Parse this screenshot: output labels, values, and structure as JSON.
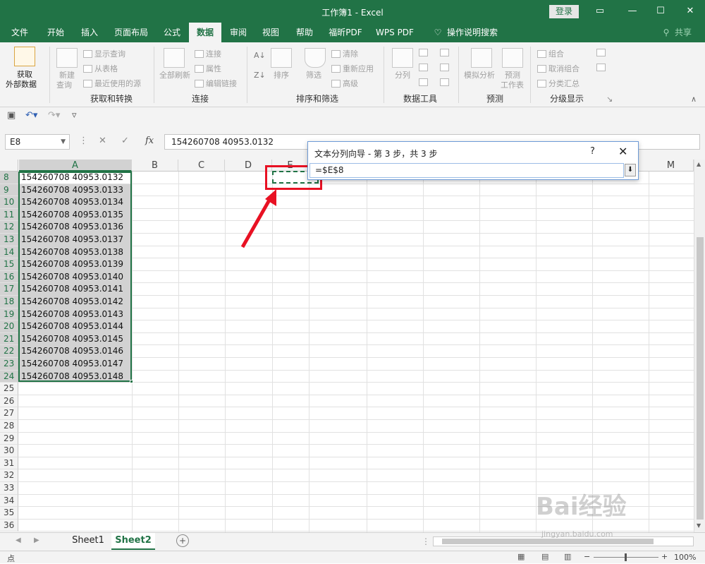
{
  "title": {
    "text": "工作簿1  -  Excel",
    "login": "登录"
  },
  "tabs": [
    "文件",
    "开始",
    "插入",
    "页面布局",
    "公式",
    "数据",
    "审阅",
    "视图",
    "帮助",
    "福昕PDF",
    "WPS PDF",
    "操作说明搜索"
  ],
  "share": "共享",
  "ribbon": {
    "get": {
      "line1": "获取",
      "line2": "外部数据",
      "new_query": "新建",
      "new_query2": "查询",
      "show_queries": "显示查询",
      "from_table": "从表格",
      "recent_sources": "最近使用的源",
      "label": "获取和转换"
    },
    "conn": {
      "refresh_all": "全部刷新",
      "connections": "连接",
      "properties": "属性",
      "edit_links": "编辑链接",
      "label": "连接"
    },
    "sort": {
      "sort": "排序",
      "filter": "筛选",
      "clear": "清除",
      "reapply": "重新应用",
      "advanced": "高级",
      "label": "排序和筛选"
    },
    "tools": {
      "split": "分列",
      "label": "数据工具"
    },
    "forecast": {
      "whatif": "模拟分析",
      "sheet1": "预测",
      "sheet2": "工作表",
      "label": "预测"
    },
    "outline": {
      "group": "组合",
      "ungroup": "取消组合",
      "subtotal": "分类汇总",
      "label": "分级显示"
    }
  },
  "formula_bar": {
    "name_box": "E8",
    "fx": "fx",
    "content": "154260708 40953.0132"
  },
  "columns": [
    "A",
    "B",
    "C",
    "D",
    "E",
    "M"
  ],
  "rows": [
    "8",
    "9",
    "10",
    "11",
    "12",
    "13",
    "14",
    "15",
    "16",
    "17",
    "18",
    "19",
    "20",
    "21",
    "22",
    "23",
    "24",
    "25",
    "26",
    "27",
    "28",
    "29",
    "30",
    "31",
    "32",
    "33",
    "34",
    "35",
    "36"
  ],
  "cells": [
    "154260708 40953.0132",
    "154260708 40953.0133",
    "154260708 40953.0134",
    "154260708 40953.0135",
    "154260708 40953.0136",
    "154260708 40953.0137",
    "154260708 40953.0138",
    "154260708 40953.0139",
    "154260708 40953.0140",
    "154260708 40953.0141",
    "154260708 40953.0142",
    "154260708 40953.0143",
    "154260708 40953.0144",
    "154260708 40953.0145",
    "154260708 40953.0146",
    "154260708 40953.0147",
    "154260708 40953.0148"
  ],
  "dialog": {
    "title": "文本分列向导 - 第 3 步，共 3 步",
    "help": "?",
    "close": "✕",
    "value": "=$E$8"
  },
  "sheets": {
    "sheet1": "Sheet1",
    "sheet2": "Sheet2",
    "add": "+"
  },
  "status": {
    "mode": "点",
    "zoom": "100%"
  },
  "watermark": {
    "main": "Bai经验",
    "sub": "jingyan.baidu.com"
  },
  "colors": {
    "excel_green": "#217346",
    "annotation_red": "#e81123"
  }
}
